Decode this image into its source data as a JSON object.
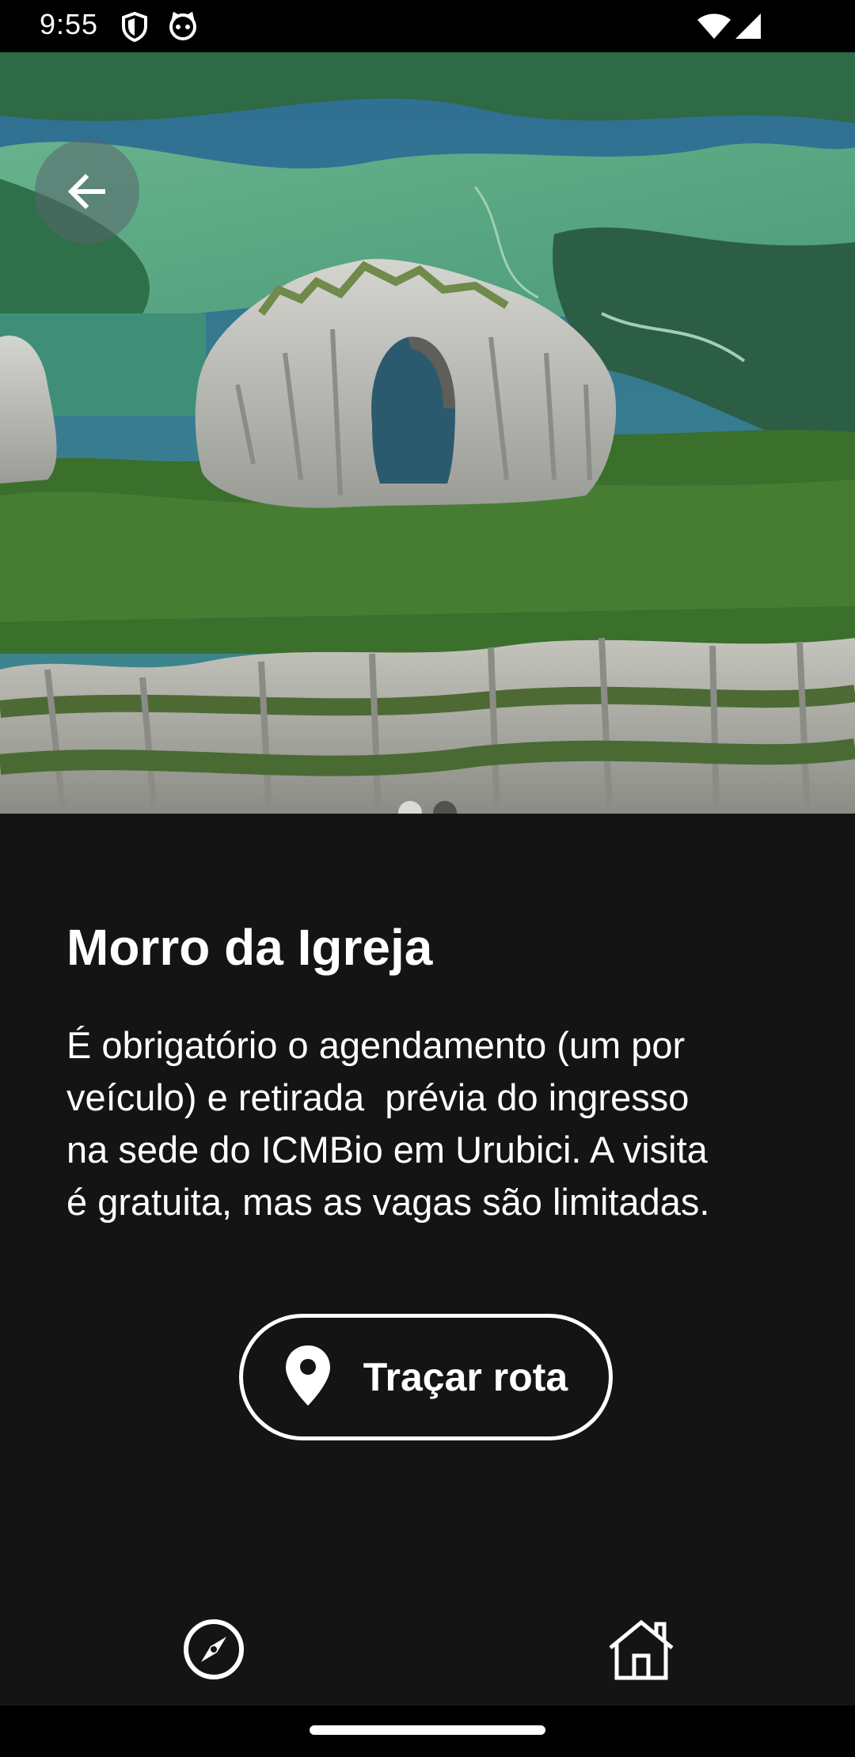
{
  "status_bar": {
    "time": "9:55",
    "left_icons": [
      "shield-icon",
      "cat-face-icon"
    ],
    "right_icons": [
      "wifi-icon",
      "cellular-signal-icon"
    ]
  },
  "hero": {
    "image": "mountain-rock-arch-photo",
    "back_icon": "arrow-left-icon",
    "carousel": {
      "count": 2,
      "active_index": 0
    }
  },
  "place": {
    "title": "Morro da Igreja",
    "description": "É obrigatório o agendamento (um por\nveículo) e retirada  prévia do ingresso\nna sede do ICMBio em Urubici. A visita\né gratuita, mas as vagas são limitadas."
  },
  "route_button": {
    "label": "Traçar rota",
    "icon": "location-pin-icon"
  },
  "bottom_nav": {
    "items": [
      {
        "icon": "compass-icon"
      },
      {
        "icon": "home-icon"
      }
    ]
  },
  "colors": {
    "background": "#141414",
    "text": "#ffffff",
    "status_bar": "#000000"
  }
}
